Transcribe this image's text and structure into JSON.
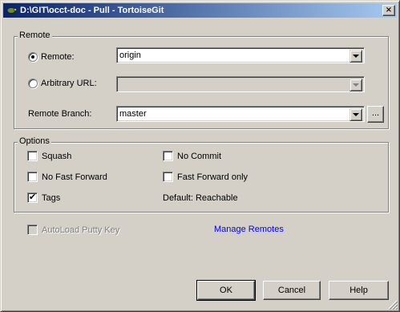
{
  "window": {
    "title": "D:\\GIT\\occt-doc - Pull - TortoiseGit",
    "close_glyph": "×"
  },
  "remote_group": {
    "legend": "Remote",
    "remote_radio_label": "Remote:",
    "remote_value": "origin",
    "url_radio_label": "Arbitrary URL:",
    "url_value": "",
    "branch_label": "Remote Branch:",
    "branch_value": "master",
    "browse_label": "..."
  },
  "options_group": {
    "legend": "Options",
    "squash": "Squash",
    "no_commit": "No Commit",
    "no_fast_forward": "No Fast Forward",
    "fast_forward_only": "Fast Forward only",
    "tags": "Tags",
    "tags_checked": true,
    "default_note": "Default: Reachable"
  },
  "autoload_label": "AutoLoad Putty Key",
  "manage_remotes_link": "Manage Remotes",
  "buttons": {
    "ok": "OK",
    "cancel": "Cancel",
    "help": "Help"
  },
  "icons": {
    "app": "tortoise-icon",
    "check": "✔"
  },
  "colors": {
    "title_start": "#0a246a",
    "title_end": "#a6caf0",
    "dialog_bg": "#d4d0c8",
    "link": "#0000ff"
  }
}
